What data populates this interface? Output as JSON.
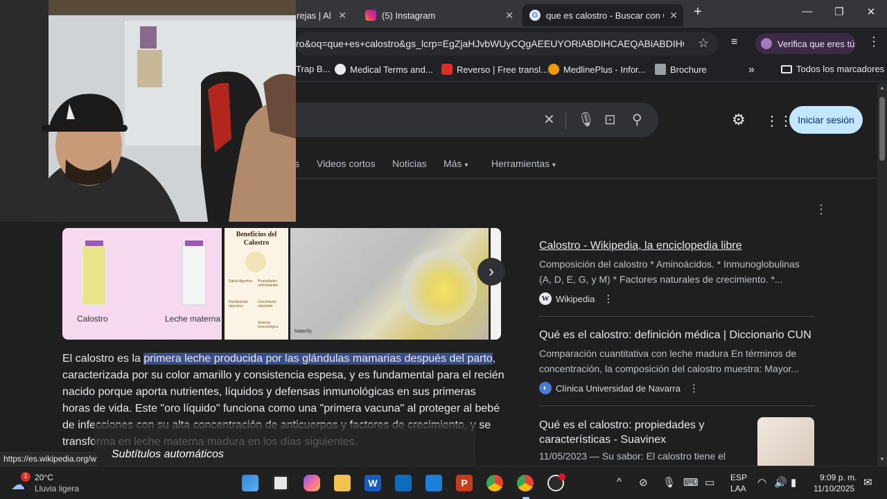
{
  "browser": {
    "tabs": [
      {
        "label": "rejas | Al",
        "active": false
      },
      {
        "label": "(5) Instagram",
        "active": false
      },
      {
        "label": "que es calostro - Buscar con Go",
        "active": true
      }
    ],
    "new_tab": "+",
    "url": "ro&oq=que+es+calostro&gs_lcrp=EgZjaHJvbWUyCQgAEEUYORiABDIHCAEQABiABDIHC...",
    "verify_label": "Verifica que eres tú",
    "bookmarks": [
      "Trap B...",
      "Medical Terms and...",
      "Reverso | Free transl...",
      "MedlinePlus - Infor...",
      "Brochure"
    ],
    "all_bookmarks": "Todos los marcadores",
    "status_url": "https://es.wikipedia.org/w"
  },
  "search": {
    "signin_label": "Iniciar sesión",
    "nav_tabs": [
      "s",
      "Videos cortos",
      "Noticias",
      "Más",
      "Herramientas"
    ],
    "images": [
      {
        "label_left": "Calostro",
        "label_right": "Leche materna"
      },
      {
        "title": "Beneficios del Calostro",
        "items": [
          "Salud digestiva",
          "Propiedades antioxidantes",
          "Rendimiento deportivo",
          "Crecimiento saludable",
          "Sistema inmunológico"
        ]
      },
      {
        "watermark": "Materify"
      }
    ],
    "answer_pre": "El calostro es la ",
    "answer_highlight": "primera leche producida por las glándulas mamarias después del parto",
    "answer_post": ", caracterizada por su color amarillo y consistencia espesa, y es fundamental para el recién nacido porque aporta nutrientes, líquidos y defensas inmunológicas en sus primeras horas de vida. Este \"oro líquido\" funciona como una \"primera vacuna\" al proteger al bebé de infecciones con su alta concentración de anticuerpos y factores de crecimiento, y se transforma en leche materna madura en los días siguientes.",
    "results": [
      {
        "title": "Calostro - Wikipedia, la enciclopedia libre",
        "snippet": "Composición del calostro * Aminoácidos. * Inmunoglobulinas (A, D, E, G, y M) * Factores naturales de crecimiento. *...",
        "source": "Wikipedia"
      },
      {
        "title": "Qué es el calostro: definición médica | Diccionario CUN",
        "snippet": "Comparación cuantitativa con leche madura En términos de concentración, la composición del calostro muestra: Mayor...",
        "source": "Clínica Universidad de Navarra"
      },
      {
        "title": "Qué es el calostro: propiedades y características - Suavinex",
        "snippet": "11/05/2023 — Su sabor: El calostro tiene el",
        "source": ""
      }
    ]
  },
  "captions": "Subtítulos automáticos",
  "taskbar": {
    "weather_temp": "20°C",
    "weather_desc": "Lluvia ligera",
    "weather_badge": "1",
    "lang1": "ESP",
    "lang2": "LAA",
    "time": "9:09 p. m.",
    "date": "11/10/2025"
  },
  "colors": {
    "signin_bg": "#c2e7ff",
    "highlight": "#3a4f8a",
    "page_bg": "#1f1f1f"
  }
}
